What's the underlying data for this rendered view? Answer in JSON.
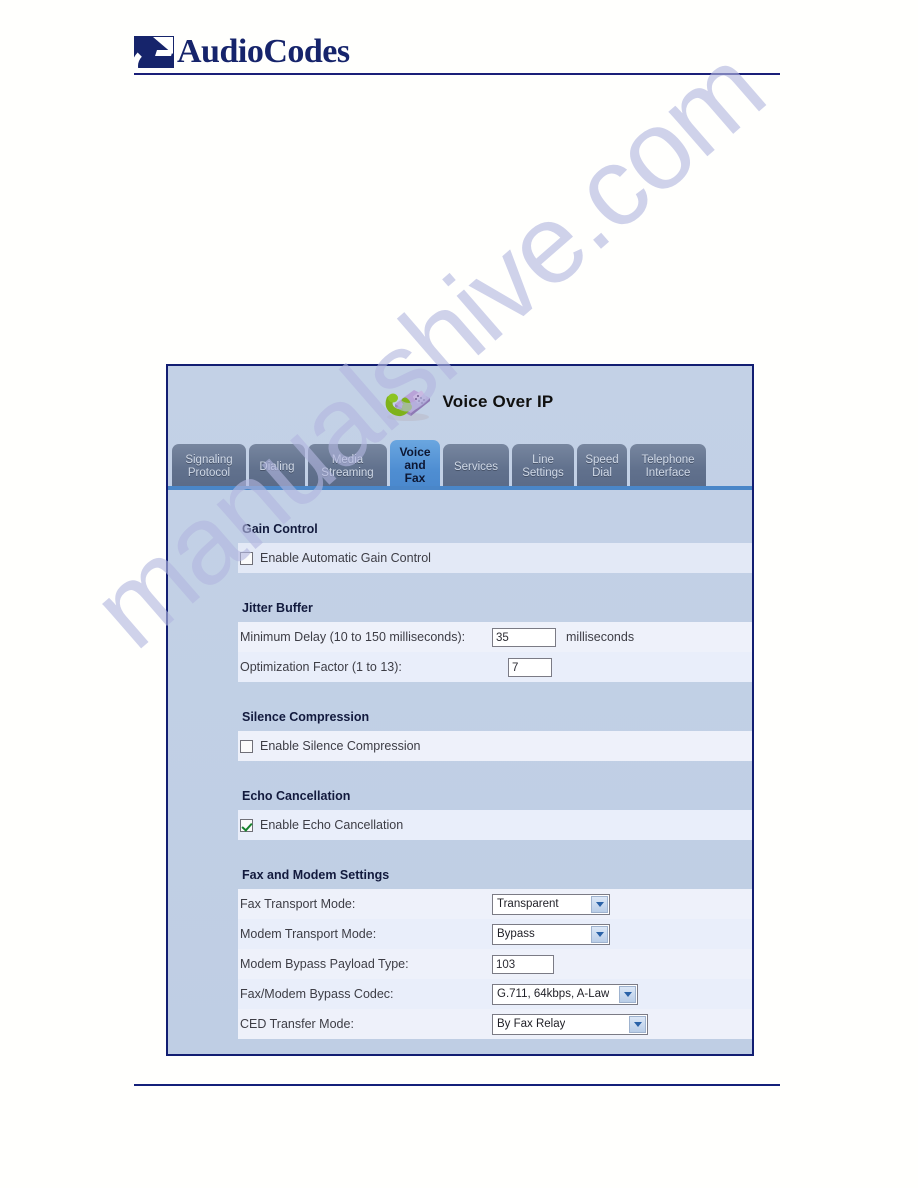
{
  "brand": {
    "logo_text_audio": "Audio",
    "logo_text_codes": "Codes",
    "logo_icon": "audiocodes-logo-icon"
  },
  "watermark": {
    "text": "manualshive.com"
  },
  "panel": {
    "title": "Voice Over IP",
    "title_icon": "telephone-icon",
    "tabs": [
      {
        "label": "Signaling\nProtocol",
        "line1": "Signaling",
        "line2": "Protocol",
        "active": false
      },
      {
        "label": "Dialing",
        "line1": "Dialing",
        "line2": "",
        "active": false
      },
      {
        "label": "Media Streaming",
        "line1": "Media",
        "line2": "Streaming",
        "active": false
      },
      {
        "label": "Voice and Fax",
        "line1": "Voice",
        "line2": "and",
        "line3": "Fax",
        "active": true
      },
      {
        "label": "Services",
        "line1": "Services",
        "line2": "",
        "active": false
      },
      {
        "label": "Line Settings",
        "line1": "Line",
        "line2": "Settings",
        "active": false
      },
      {
        "label": "Speed Dial",
        "line1": "Speed",
        "line2": "Dial",
        "active": false
      },
      {
        "label": "Telephone Interface",
        "line1": "Telephone",
        "line2": "Interface",
        "active": false
      }
    ],
    "sections": {
      "gain_control": {
        "title": "Gain Control",
        "checkbox_label": "Enable Automatic Gain Control",
        "checked": false
      },
      "jitter_buffer": {
        "title": "Jitter Buffer",
        "minimum_delay_label": "Minimum Delay (10 to 150 milliseconds):",
        "minimum_delay_value": "35",
        "minimum_delay_unit": "milliseconds",
        "optimization_factor_label": "Optimization Factor (1 to 13):",
        "optimization_factor_value": "7"
      },
      "silence_compression": {
        "title": "Silence Compression",
        "checkbox_label": "Enable Silence Compression",
        "checked": false
      },
      "echo_cancellation": {
        "title": "Echo Cancellation",
        "checkbox_label": "Enable Echo Cancellation",
        "checked": true
      },
      "fax_modem": {
        "title": "Fax and Modem Settings",
        "fax_transport_label": "Fax Transport Mode:",
        "fax_transport_value": "Transparent",
        "modem_transport_label": "Modem Transport Mode:",
        "modem_transport_value": "Bypass",
        "modem_bypass_payload_label": "Modem Bypass Payload Type:",
        "modem_bypass_payload_value": "103",
        "bypass_codec_label": "Fax/Modem Bypass Codec:",
        "bypass_codec_value": "G.711, 64kbps, A-Law",
        "ced_transfer_label": "CED Transfer Mode:",
        "ced_transfer_value": "By Fax Relay"
      }
    }
  },
  "colors": {
    "brand_navy": "#16246b",
    "panel_border": "#121e72",
    "panel_bg": "#c3d1e6",
    "tab_inactive": "#61718d",
    "tab_active": "#4f8ed2",
    "check_green": "#17822c",
    "watermark": "#b3b7e0"
  }
}
